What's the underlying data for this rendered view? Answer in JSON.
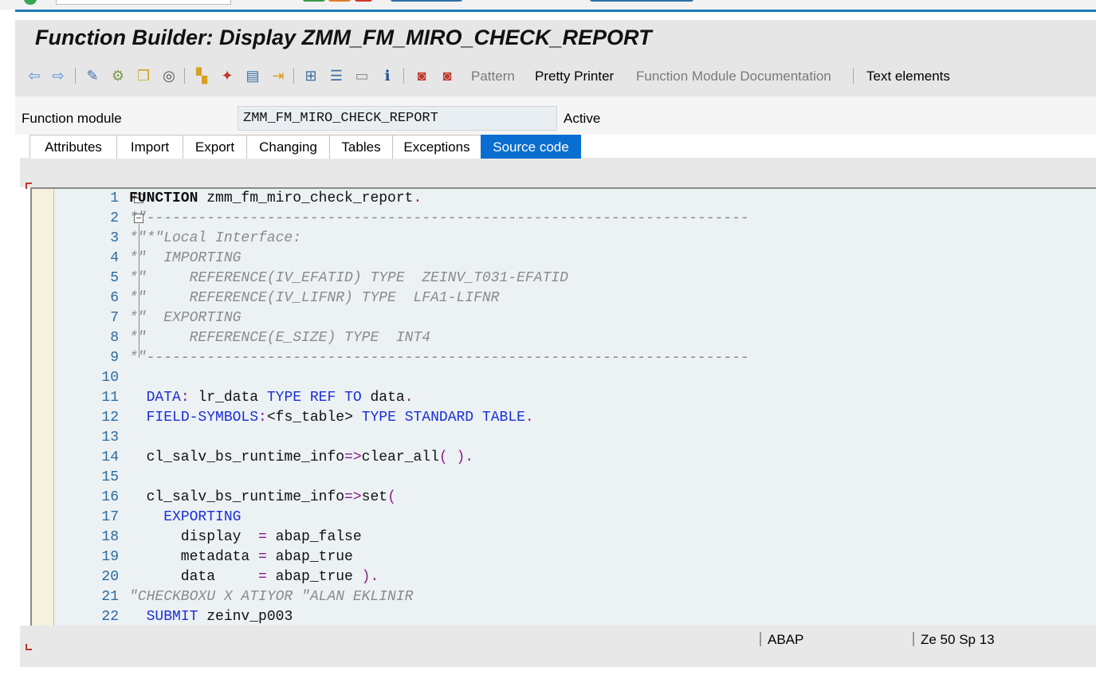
{
  "title": "Function Builder: Display ZMM_FM_MIRO_CHECK_REPORT",
  "toolbar": {
    "icons": [
      "back-arrow-icon",
      "forward-arrow-icon",
      "display-change-icon",
      "active-inactive-icon",
      "copy-icon",
      "where-used-icon",
      "object-list-icon",
      "test-icon",
      "inspect-icon",
      "navigate-icon",
      "hierarchy-icon",
      "stack-icon",
      "frame-icon",
      "info-icon",
      "debug-session-icon",
      "external-breakpoint-icon"
    ],
    "pattern": "Pattern",
    "pretty_printer": "Pretty Printer",
    "fm_documentation": "Function Module Documentation",
    "text_elements": "Text elements"
  },
  "header": {
    "label": "Function module",
    "value": "ZMM_FM_MIRO_CHECK_REPORT",
    "status": "Active"
  },
  "tabs": [
    "Attributes",
    "Import",
    "Export",
    "Changing",
    "Tables",
    "Exceptions",
    "Source code"
  ],
  "active_tab": "Source code",
  "code": {
    "lines": [
      {
        "n": "1",
        "tokens": [
          [
            "kwb",
            "FUNCTION"
          ],
          [
            "id",
            " zmm_fm_miro_check_report"
          ],
          [
            "op",
            "."
          ]
        ]
      },
      {
        "n": "2",
        "tokens": [
          [
            "cm",
            "*\"----------------------------------------------------------------------"
          ]
        ]
      },
      {
        "n": "3",
        "tokens": [
          [
            "cm",
            "*\"*\"Local Interface:"
          ]
        ]
      },
      {
        "n": "4",
        "tokens": [
          [
            "cm",
            "*\"  IMPORTING"
          ]
        ]
      },
      {
        "n": "5",
        "tokens": [
          [
            "cm",
            "*\"     REFERENCE(IV_EFATID) TYPE  ZEINV_T031-EFATID"
          ]
        ]
      },
      {
        "n": "6",
        "tokens": [
          [
            "cm",
            "*\"     REFERENCE(IV_LIFNR) TYPE  LFA1-LIFNR"
          ]
        ]
      },
      {
        "n": "7",
        "tokens": [
          [
            "cm",
            "*\"  EXPORTING"
          ]
        ]
      },
      {
        "n": "8",
        "tokens": [
          [
            "cm",
            "*\"     REFERENCE(E_SIZE) TYPE  INT4"
          ]
        ]
      },
      {
        "n": "9",
        "tokens": [
          [
            "cm",
            "*\"----------------------------------------------------------------------"
          ]
        ]
      },
      {
        "n": "10",
        "tokens": []
      },
      {
        "n": "11",
        "tokens": [
          [
            "id",
            "  "
          ],
          [
            "kw",
            "DATA"
          ],
          [
            "op",
            ":"
          ],
          [
            "id",
            " lr_data "
          ],
          [
            "kw",
            "TYPE REF TO"
          ],
          [
            "id",
            " data"
          ],
          [
            "op",
            "."
          ]
        ]
      },
      {
        "n": "12",
        "tokens": [
          [
            "id",
            "  "
          ],
          [
            "kw",
            "FIELD-SYMBOLS"
          ],
          [
            "op",
            ":"
          ],
          [
            "id",
            "<fs_table> "
          ],
          [
            "kw",
            "TYPE STANDARD TABLE"
          ],
          [
            "op",
            "."
          ]
        ]
      },
      {
        "n": "13",
        "tokens": []
      },
      {
        "n": "14",
        "tokens": [
          [
            "id",
            "  cl_salv_bs_runtime_info"
          ],
          [
            "op",
            "=>"
          ],
          [
            "id",
            "clear_all"
          ],
          [
            "op",
            "( )."
          ]
        ]
      },
      {
        "n": "15",
        "tokens": []
      },
      {
        "n": "16",
        "tokens": [
          [
            "id",
            "  cl_salv_bs_runtime_info"
          ],
          [
            "op",
            "=>"
          ],
          [
            "id",
            "set"
          ],
          [
            "op",
            "("
          ]
        ]
      },
      {
        "n": "17",
        "tokens": [
          [
            "id",
            "    "
          ],
          [
            "kw",
            "EXPORTING"
          ]
        ]
      },
      {
        "n": "18",
        "tokens": [
          [
            "id",
            "      display  "
          ],
          [
            "op",
            "="
          ],
          [
            "id",
            " abap_false"
          ]
        ]
      },
      {
        "n": "19",
        "tokens": [
          [
            "id",
            "      metadata "
          ],
          [
            "op",
            "="
          ],
          [
            "id",
            " abap_true"
          ]
        ]
      },
      {
        "n": "20",
        "tokens": [
          [
            "id",
            "      data     "
          ],
          [
            "op",
            "="
          ],
          [
            "id",
            " abap_true "
          ],
          [
            "op",
            ")."
          ]
        ]
      },
      {
        "n": "21",
        "tokens": [
          [
            "cm",
            "\"CHECKBOXU X ATIYOR \"ALAN EKLINIR"
          ]
        ]
      },
      {
        "n": "22",
        "tokens": [
          [
            "id",
            "  "
          ],
          [
            "kw",
            "SUBMIT"
          ],
          [
            "id",
            " zeinv_p003"
          ]
        ]
      }
    ]
  },
  "status": {
    "language": "ABAP",
    "position": "Ze  50 Sp  13"
  }
}
